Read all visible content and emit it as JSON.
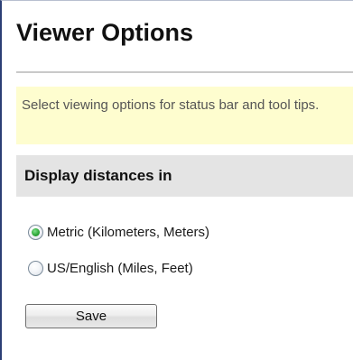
{
  "page_title": "Viewer Options",
  "info_text": "Select viewing options for status bar and tool tips.",
  "section": {
    "header": "Display distances in",
    "options": [
      {
        "label": "Metric (Kilometers, Meters)",
        "checked": true
      },
      {
        "label": "US/English (Miles, Feet)",
        "checked": false
      }
    ]
  },
  "actions": {
    "save_label": "Save"
  },
  "colors": {
    "accent_border": "#2b3f75",
    "info_background": "#fefdcf",
    "section_background": "#e4e4e4",
    "radio_selected": "#2fa83a"
  }
}
